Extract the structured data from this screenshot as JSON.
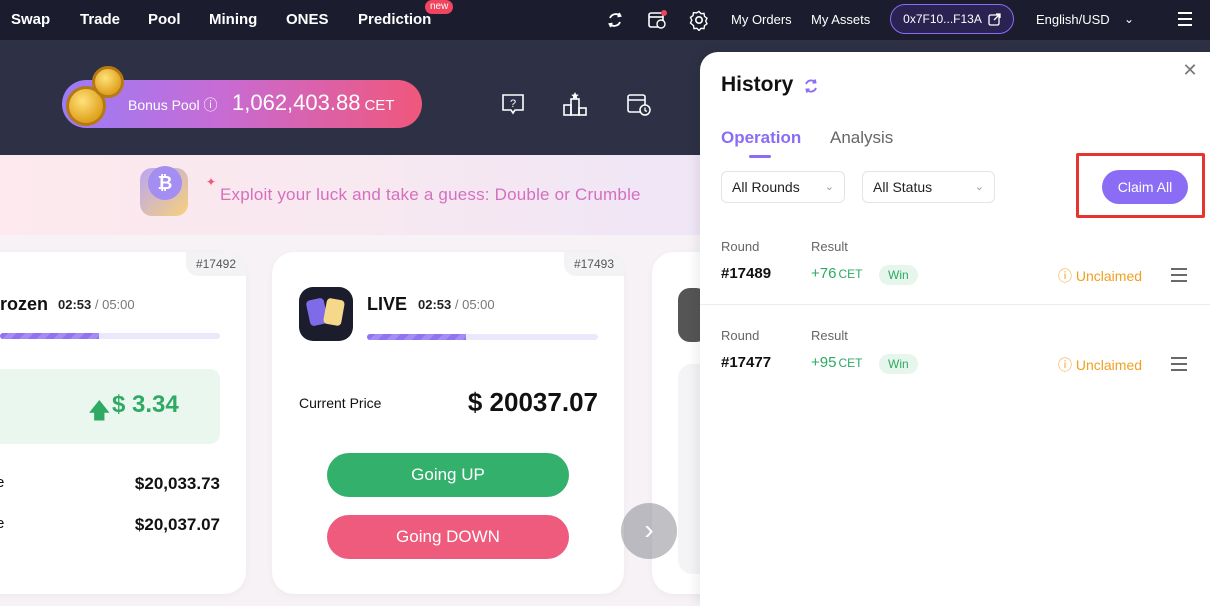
{
  "nav": {
    "items": [
      "Swap",
      "Trade",
      "Pool",
      "Mining",
      "ONES",
      "Prediction"
    ],
    "new_badge": "new",
    "my_orders": "My Orders",
    "my_assets": "My Assets",
    "wallet": "0x7F10...F13A",
    "language": "English/USD"
  },
  "hero": {
    "bonus_label": "Bonus Pool",
    "bonus_value": "1,062,403.88",
    "bonus_unit": "CET"
  },
  "banner": {
    "text": "Exploit your luck and take a guess: Double or Crumble"
  },
  "cards": {
    "left": {
      "id": "#17492",
      "status": "rozen",
      "time": "02:53",
      "duration": "/ 05:00",
      "progress": 0.45,
      "change": "$ 3.34",
      "row1_label": "e",
      "row1_value": "$20,033.73",
      "row2_label": "e",
      "row2_value": "$20,037.07"
    },
    "live": {
      "id": "#17493",
      "status": "LIVE",
      "time": "02:53",
      "duration": "/ 05:00",
      "progress": 0.43,
      "price_label": "Current Price",
      "price_value": "$ 20037.07",
      "up_label": "Going UP",
      "down_label": "Going DOWN"
    }
  },
  "history": {
    "title": "History",
    "tabs": [
      "Operation",
      "Analysis"
    ],
    "active_tab": "Operation",
    "filter_rounds": "All Rounds",
    "filter_status": "All Status",
    "claim_all": "Claim All",
    "round_label": "Round",
    "result_label": "Result",
    "rows": [
      {
        "round": "#17489",
        "result": "+76",
        "unit": "CET",
        "badge": "Win",
        "status": "Unclaimed"
      },
      {
        "round": "#17477",
        "result": "+95",
        "unit": "CET",
        "badge": "Win",
        "status": "Unclaimed"
      }
    ]
  },
  "colors": {
    "accent": "#8a6cf5",
    "up": "#33b06b",
    "down": "#ee5b7c",
    "warning": "#f0a020",
    "highlight": "#e8342e"
  }
}
